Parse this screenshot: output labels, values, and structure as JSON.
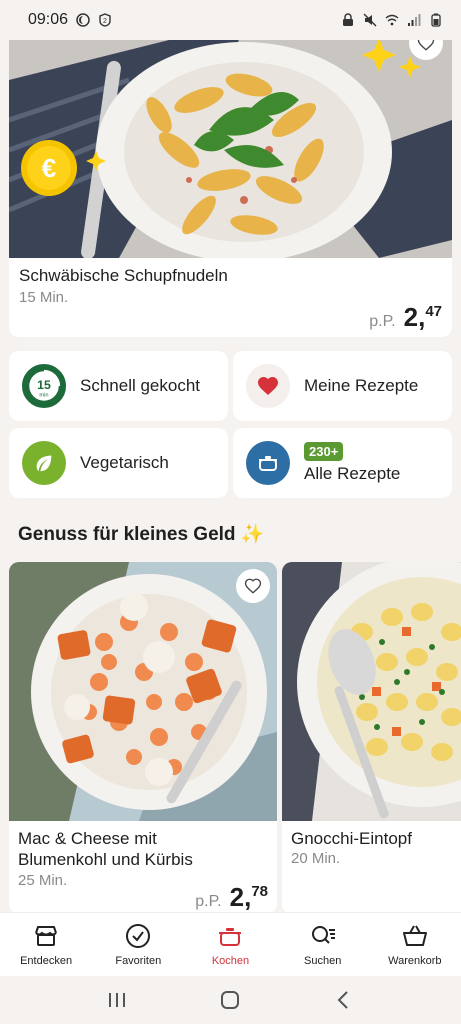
{
  "status_bar": {
    "time": "09:06"
  },
  "hero": {
    "title": "Schwäbische Schupfnudeln",
    "time": "15 Min.",
    "price_prefix": "p.P.",
    "price_whole": "2,",
    "price_cents": "47"
  },
  "quick_tiles": {
    "quick_cooked": "Schnell gekocht",
    "quick_icon_text": "15",
    "quick_icon_sub": "min",
    "my_recipes": "Meine Rezepte",
    "vegetarian": "Vegetarisch",
    "all_recipes_badge": "230+",
    "all_recipes": "Alle Rezepte"
  },
  "section": {
    "title": "Genuss für kleines Geld ✨"
  },
  "recipes": [
    {
      "title_line1": "Mac & Cheese mit",
      "title_line2": "Blumenkohl und Kürbis",
      "time": "25 Min.",
      "price_prefix": "p.P.",
      "price_whole": "2,",
      "price_cents": "78"
    },
    {
      "title_line1": "Gnocchi-Eintopf",
      "time": "20 Min."
    }
  ],
  "bottom_nav": [
    {
      "label": "Entdecken",
      "icon": "store-icon"
    },
    {
      "label": "Favoriten",
      "icon": "check-circle-icon"
    },
    {
      "label": "Kochen",
      "icon": "pot-icon",
      "active": true
    },
    {
      "label": "Suchen",
      "icon": "search-list-icon"
    },
    {
      "label": "Warenkorb",
      "icon": "basket-icon"
    }
  ],
  "colors": {
    "accent": "#d6323a",
    "badge_green": "#5b9a32",
    "quick_green": "#1d6b3a",
    "veg_green": "#7ab22e",
    "pot_blue": "#2d6fa5",
    "background": "#f6f2ef"
  }
}
